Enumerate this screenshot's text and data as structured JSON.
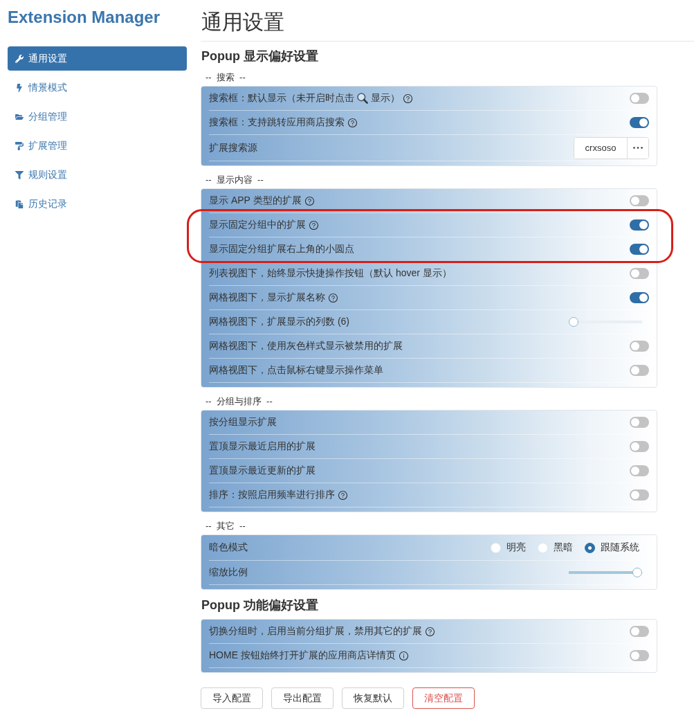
{
  "app_title": "Extension Manager",
  "sidebar": {
    "items": [
      {
        "label": "通用设置",
        "selected": true
      },
      {
        "label": "情景模式",
        "selected": false
      },
      {
        "label": "分组管理",
        "selected": false
      },
      {
        "label": "扩展管理",
        "selected": false
      },
      {
        "label": "规则设置",
        "selected": false
      },
      {
        "label": "历史记录",
        "selected": false
      }
    ]
  },
  "page_title": "通用设置",
  "groups": [
    {
      "heading": "Popup 显示偏好设置",
      "sections": [
        {
          "label": "--  搜索  --",
          "rows": [
            {
              "kind": "toggle",
              "label": "搜索框：默认显示（未开启时点击",
              "label_suffix": "显示）",
              "hint": {
                "kind": "help"
              },
              "on": false
            },
            {
              "kind": "toggle",
              "label": "搜索框：支持跳转应用商店搜索",
              "hint": {
                "kind": "help"
              },
              "on": true
            },
            {
              "kind": "select",
              "label": "扩展搜索源",
              "value": "crxsoso"
            }
          ]
        },
        {
          "label": "--  显示内容  --",
          "rows": [
            {
              "kind": "toggle",
              "label": "显示 APP 类型的扩展",
              "hint": {
                "kind": "help"
              },
              "on": false,
              "highlighted": false
            },
            {
              "kind": "toggle",
              "label": "显示固定分组中的扩展",
              "hint": {
                "kind": "help"
              },
              "on": true,
              "highlighted": true
            },
            {
              "kind": "toggle",
              "label": "显示固定分组扩展右上角的小圆点",
              "on": true,
              "highlighted": true
            },
            {
              "kind": "toggle",
              "label": "列表视图下，始终显示快捷操作按钮（默认 hover 显示）",
              "on": false,
              "highlighted": false
            },
            {
              "kind": "toggle",
              "label": "网格视图下，显示扩展名称",
              "hint": {
                "kind": "help"
              },
              "on": true,
              "highlighted": false
            },
            {
              "kind": "slider",
              "label": "网格视图下，扩展显示的列数 (6)",
              "level": 0,
              "highlighted": false
            },
            {
              "kind": "toggle",
              "label": "网格视图下，使用灰色样式显示被禁用的扩展",
              "on": false,
              "highlighted": false
            },
            {
              "kind": "toggle",
              "label": "网格视图下，点击鼠标右键显示操作菜单",
              "on": false,
              "highlighted": false
            }
          ]
        },
        {
          "label": "--  分组与排序  --",
          "rows": [
            {
              "kind": "toggle",
              "label": "按分组显示扩展",
              "on": false
            },
            {
              "kind": "toggle",
              "label": "置顶显示最近启用的扩展",
              "on": false
            },
            {
              "kind": "toggle",
              "label": "置顶显示最近更新的扩展",
              "on": false
            },
            {
              "kind": "toggle",
              "label": "排序：按照启用频率进行排序",
              "hint": {
                "kind": "help"
              },
              "on": false
            }
          ]
        },
        {
          "label": "--  其它  --",
          "rows": [
            {
              "kind": "radio",
              "label": "暗色模式",
              "options": [
                {
                  "label": "明亮",
                  "selected": false
                },
                {
                  "label": "黑暗",
                  "selected": false
                },
                {
                  "label": "跟随系统",
                  "selected": true
                }
              ]
            },
            {
              "kind": "slider",
              "label": "缩放比例",
              "level": 1
            }
          ]
        }
      ]
    },
    {
      "heading": "Popup 功能偏好设置",
      "sections": [
        {
          "rows": [
            {
              "kind": "toggle",
              "label": "切换分组时，启用当前分组扩展，禁用其它的扩展",
              "hint": {
                "kind": "help"
              },
              "on": false
            },
            {
              "kind": "toggle",
              "label": "HOME 按钮始终打开扩展的应用商店详情页",
              "hint": {
                "kind": "info"
              },
              "on": false
            }
          ]
        }
      ]
    }
  ],
  "buttons": [
    {
      "label": "导入配置",
      "kind": "default"
    },
    {
      "label": "导出配置",
      "kind": "default"
    },
    {
      "label": "恢复默认",
      "kind": "default"
    },
    {
      "label": "清空配置",
      "kind": "danger"
    }
  ]
}
